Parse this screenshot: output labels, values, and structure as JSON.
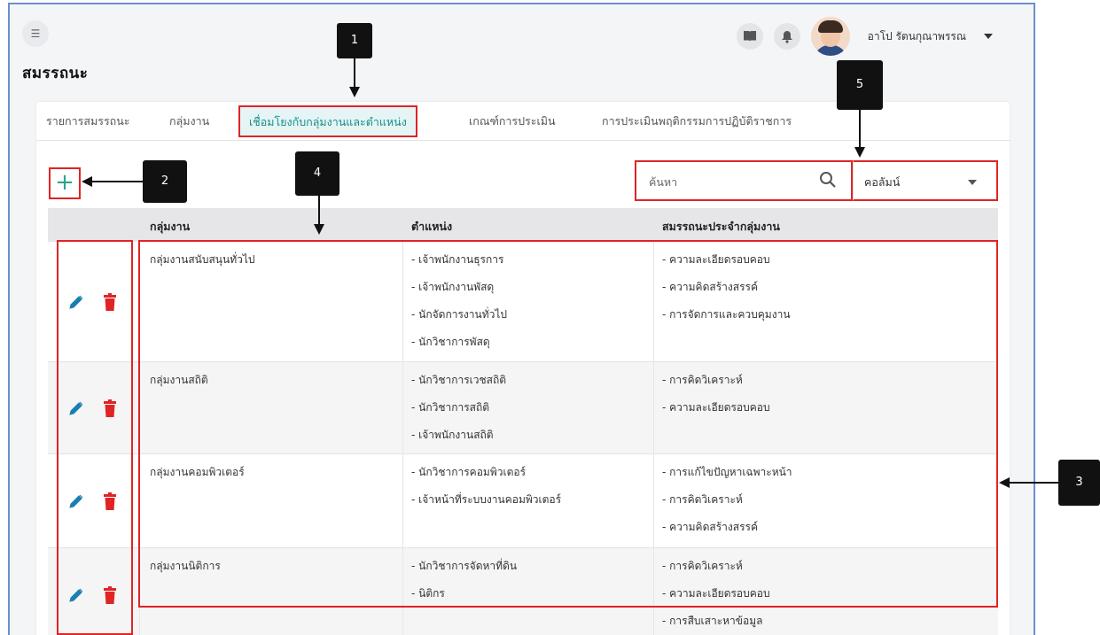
{
  "header": {
    "user_name": "อาโป รัตนกุณาพรรณ",
    "page_title": "สมรรถนะ"
  },
  "tabs": [
    {
      "label": "รายการสมรรถนะ",
      "active": false
    },
    {
      "label": "กลุ่มงาน",
      "active": false
    },
    {
      "label": "เชื่อมโยงกับกลุ่มงานและตำแหน่ง",
      "active": true
    },
    {
      "label": "เกณฑ์การประเมิน",
      "active": false
    },
    {
      "label": "การประเมินพฤติกรรมการปฏิบัติราชการ",
      "active": false
    }
  ],
  "toolbar": {
    "add_label": "+",
    "search_placeholder": "ค้นหา",
    "column_label": "คอลัมน์"
  },
  "table": {
    "headers": [
      "กลุ่มงาน",
      "ตำแหน่ง",
      "สมรรถนะประจำกลุ่มงาน"
    ],
    "rows": [
      {
        "group": "กลุ่มงานสนับสนุนทั่วไป",
        "positions": [
          "- เจ้าพนักงานธุรการ",
          "- เจ้าพนักงานพัสดุ",
          "- นักจัดการงานทั่วไป",
          "- นักวิชาการพัสดุ"
        ],
        "competencies": [
          "- ความละเอียดรอบคอบ",
          "- ความคิดสร้างสรรค์",
          "- การจัดการและควบคุมงาน"
        ]
      },
      {
        "group": "กลุ่มงานสถิติ",
        "positions": [
          "- นักวิชาการเวชสถิติ",
          "- นักวิชาการสถิติ",
          "- เจ้าพนักงานสถิติ"
        ],
        "competencies": [
          "- การคิดวิเคราะห์",
          "- ความละเอียดรอบคอบ"
        ]
      },
      {
        "group": "กลุ่มงานคอมพิวเตอร์",
        "positions": [
          "- นักวิชาการคอมพิวเตอร์",
          "- เจ้าหน้าที่ระบบงานคอมพิวเตอร์"
        ],
        "competencies": [
          "- การแก้ไขปัญหาเฉพาะหน้า",
          "- การคิดวิเคราะห์",
          "- ความคิดสร้างสรรค์"
        ]
      },
      {
        "group": "กลุ่มงานนิติการ",
        "positions": [
          "- นักวิชาการจัดหาที่ดิน",
          "- นิติกร"
        ],
        "competencies": [
          "- การคิดวิเคราะห์",
          "- ความละเอียดรอบคอบ",
          "- การสืบเสาะหาข้อมูล"
        ]
      }
    ]
  },
  "callouts": [
    "1",
    "2",
    "3",
    "4",
    "5"
  ],
  "colors": {
    "accent": "#168d8d",
    "highlight": "#e02424",
    "edit_icon": "#1a7fb0",
    "delete_icon": "#e02424"
  }
}
